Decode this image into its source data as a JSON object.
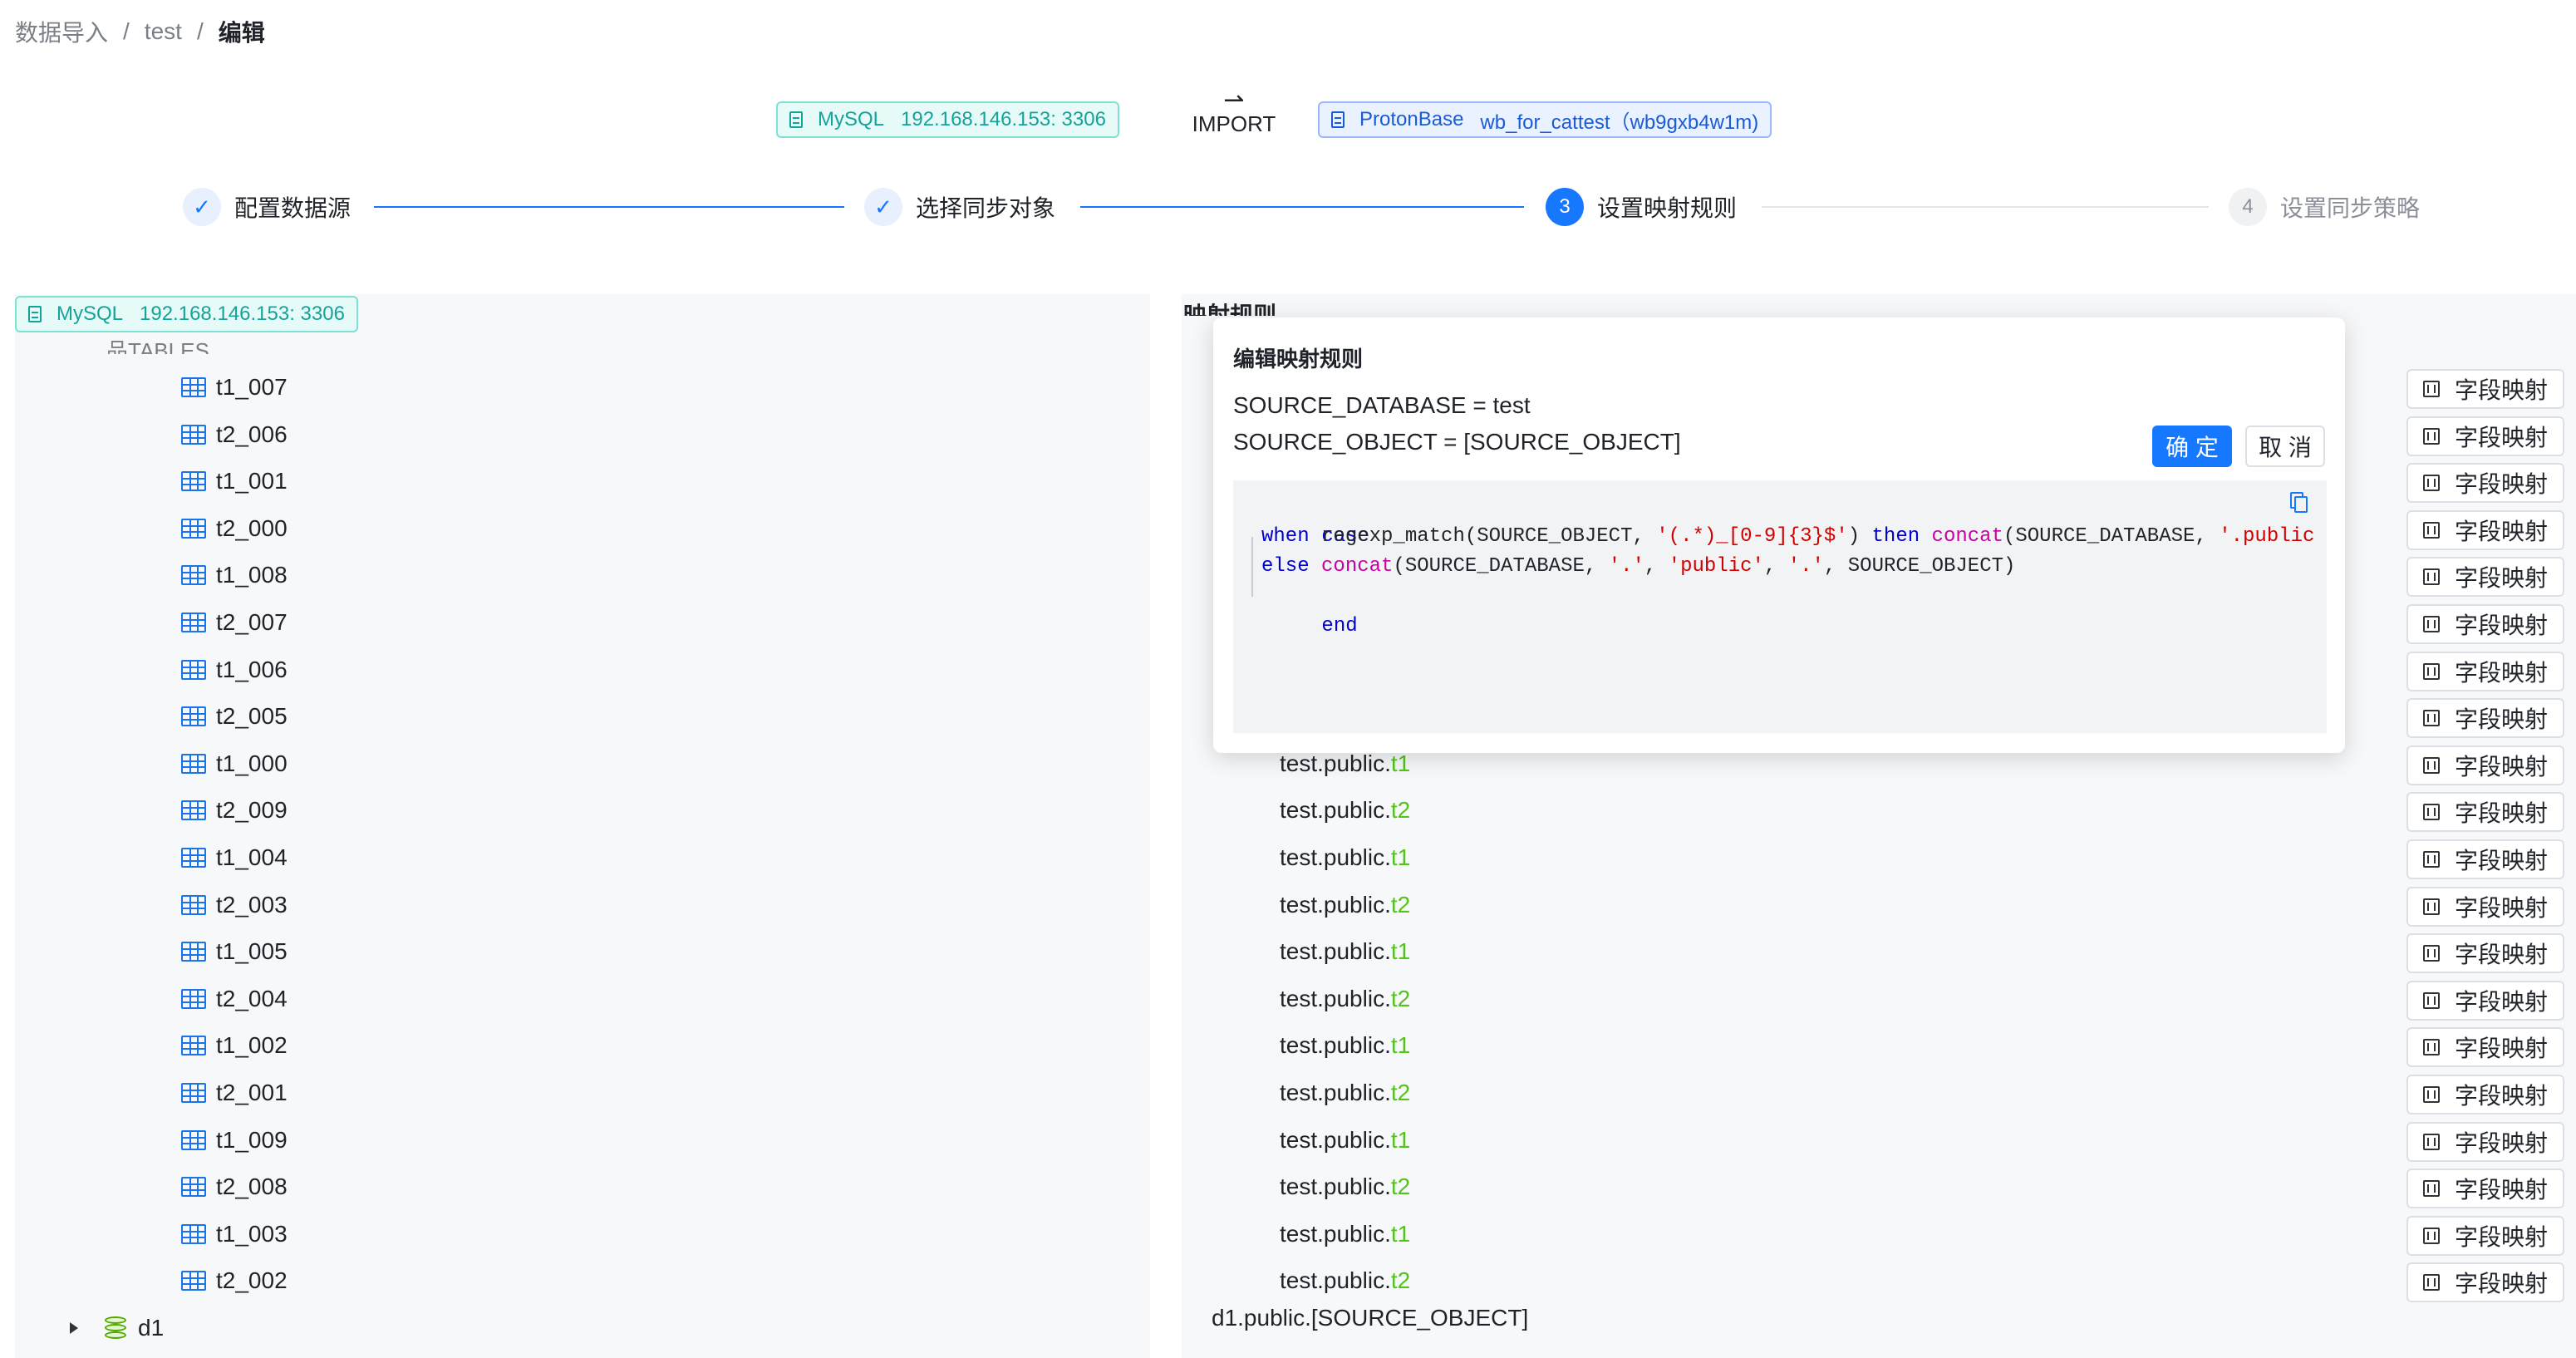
{
  "breadcrumb": {
    "item1": "数据导入",
    "item2": "test",
    "current": "编辑",
    "sep": "/"
  },
  "header": {
    "source_type": "MySQL",
    "source_addr": "192.168.146.153: 3306",
    "import_label": "IMPORT",
    "arrow": "⇀",
    "target_type": "ProtonBase",
    "target_name": "wb_for_cattest（wb9gxb4w1m)"
  },
  "steps": [
    {
      "label": "配置数据源",
      "status": "done",
      "icon": "check-icon",
      "marker": "✓"
    },
    {
      "label": "选择同步对象",
      "status": "done",
      "icon": "check-icon",
      "marker": "✓"
    },
    {
      "label": "设置映射规则",
      "status": "active",
      "number": "3"
    },
    {
      "label": "设置同步策略",
      "status": "pending",
      "number": "4"
    }
  ],
  "left_panel": {
    "source_type": "MySQL",
    "source_addr": "192.168.146.153: 3306",
    "tables_header": "品TABLES",
    "tables": [
      "t1_007",
      "t2_006",
      "t1_001",
      "t2_000",
      "t1_008",
      "t2_007",
      "t1_006",
      "t2_005",
      "t1_000",
      "t2_009",
      "t1_004",
      "t2_003",
      "t1_005",
      "t2_004",
      "t1_002",
      "t2_001",
      "t1_009",
      "t2_008",
      "t1_003",
      "t2_002"
    ],
    "database": "d1"
  },
  "right_panel": {
    "title": "映射规则",
    "field_button_label": "字段映射",
    "visible_mappings": [
      {
        "prefix": "test.public.",
        "suffix": "t1"
      },
      {
        "prefix": "test.public.",
        "suffix": "t2"
      },
      {
        "prefix": "test.public.",
        "suffix": "t1"
      },
      {
        "prefix": "test.public.",
        "suffix": "t2"
      },
      {
        "prefix": "test.public.",
        "suffix": "t1"
      },
      {
        "prefix": "test.public.",
        "suffix": "t2"
      },
      {
        "prefix": "test.public.",
        "suffix": "t1"
      },
      {
        "prefix": "test.public.",
        "suffix": "t2"
      },
      {
        "prefix": "test.public.",
        "suffix": "t1"
      },
      {
        "prefix": "test.public.",
        "suffix": "t2"
      },
      {
        "prefix": "test.public.",
        "suffix": "t1"
      },
      {
        "prefix": "test.public.",
        "suffix": "t2"
      }
    ],
    "d1_target": "d1.public.[SOURCE_OBJECT]"
  },
  "popover": {
    "title": "编辑映射规则",
    "source_database": "SOURCE_DATABASE = test",
    "source_object": "SOURCE_OBJECT = [SOURCE_OBJECT]",
    "ok_label": "确 定",
    "cancel_label": "取 消",
    "code": {
      "case": "case",
      "when": "when",
      "regexp": "regexp_match",
      "arg1": "(SOURCE_OBJECT, ",
      "pattern": "'(.*)_[0-9]{3}$'",
      "close": ")",
      "then": "then",
      "concat": "concat",
      "arg2": "(SOURCE_DATABASE, ",
      "pub_str": "'.public",
      "else": "else",
      "dot": "'.'",
      "comma": ", ",
      "public": "'public'",
      "tail": ", SOURCE_OBJECT)",
      "end": "end"
    }
  },
  "colors": {
    "primary": "#1677ff",
    "mysql_teal": "#14a39a",
    "suffix_green": "#52c41a"
  }
}
